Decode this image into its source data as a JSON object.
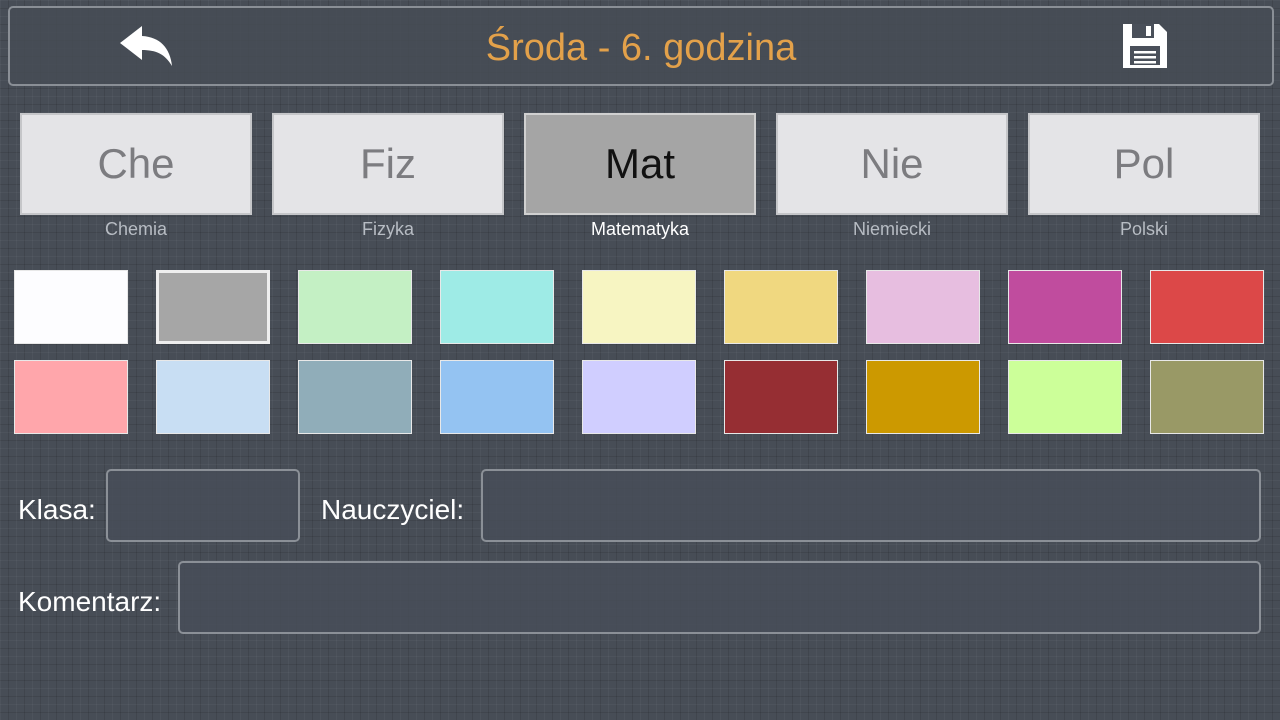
{
  "header": {
    "title": "Środa - 6. godzina",
    "back_icon": "back-arrow-icon",
    "save_icon": "floppy-disk-icon",
    "title_color": "#e3a14a"
  },
  "subjects": [
    {
      "abbr": "Che",
      "name": "Chemia"
    },
    {
      "abbr": "Fiz",
      "name": "Fizyka"
    },
    {
      "abbr": "Mat",
      "name": "Matematyka",
      "selected": true
    },
    {
      "abbr": "Nie",
      "name": "Niemiecki"
    },
    {
      "abbr": "Pol",
      "name": "Polski"
    }
  ],
  "colors": [
    [
      "#fdfdff",
      "#a6a6a6",
      "#c4f0c4",
      "#9eebe6",
      "#f7f5c2",
      "#f0d880",
      "#e7bee0",
      "#c04c9e",
      "#dc4848"
    ],
    [
      "#ffa6ab",
      "#c8def3",
      "#90adb9",
      "#94c3f2",
      "#d0ceff",
      "#962e33",
      "#cc9900",
      "#ccff99",
      "#999966"
    ]
  ],
  "selected_color": "#a6a6a6",
  "form": {
    "klasa_label": "Klasa:",
    "klasa_value": "",
    "nauczyciel_label": "Nauczyciel:",
    "nauczyciel_value": "",
    "komentarz_label": "Komentarz:",
    "komentarz_value": ""
  }
}
